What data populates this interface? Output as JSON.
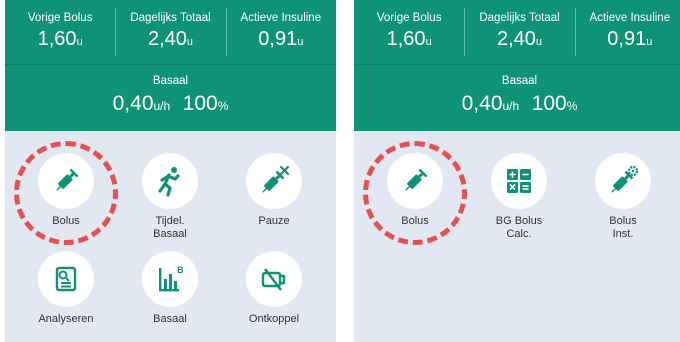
{
  "left": {
    "stats": [
      {
        "label": "Vorige Bolus",
        "value": "1,60",
        "unit": "u"
      },
      {
        "label": "Dagelijks Totaal",
        "value": "2,40",
        "unit": "u"
      },
      {
        "label": "Actieve Insuline",
        "value": "0,91",
        "unit": "u"
      }
    ],
    "basal": {
      "label": "Basaal",
      "value": "0,40",
      "unit": "u/h",
      "percent": "100",
      "percent_unit": "%"
    },
    "tiles": [
      {
        "label": "Bolus",
        "icon": "syringe-icon"
      },
      {
        "label": "Tijdel.\nBasaal",
        "icon": "runner-icon"
      },
      {
        "label": "Pauze",
        "icon": "syringe-pause-icon"
      },
      {
        "label": "Analyseren",
        "icon": "report-icon"
      },
      {
        "label": "Basaal",
        "icon": "bar-chart-icon"
      },
      {
        "label": "Ontkoppel",
        "icon": "disconnect-icon"
      }
    ]
  },
  "right": {
    "stats": [
      {
        "label": "Vorige Bolus",
        "value": "1,60",
        "unit": "u"
      },
      {
        "label": "Dagelijks Totaal",
        "value": "2,40",
        "unit": "u"
      },
      {
        "label": "Actieve Insuline",
        "value": "0,91",
        "unit": "u"
      }
    ],
    "basal": {
      "label": "Basaal",
      "value": "0,40",
      "unit": "u/h",
      "percent": "100",
      "percent_unit": "%"
    },
    "tiles": [
      {
        "label": "Bolus",
        "icon": "syringe-icon"
      },
      {
        "label": "BG Bolus\nCalc.",
        "icon": "calculator-icon"
      },
      {
        "label": "Bolus\nInst.",
        "icon": "syringe-settings-icon"
      }
    ]
  },
  "colors": {
    "teal": "#0f9377",
    "background": "#e2e8f1",
    "highlight": "#e8504f"
  }
}
